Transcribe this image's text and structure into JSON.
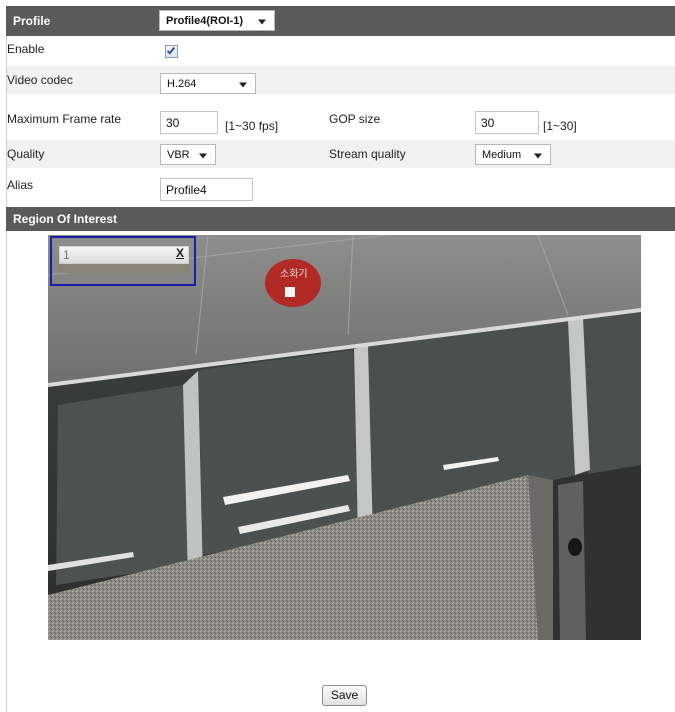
{
  "header": {
    "profile_label": "Profile",
    "profile_value": "Profile4(ROI-1)"
  },
  "enable": {
    "label": "Enable",
    "checked": true
  },
  "video_codec": {
    "label": "Video codec",
    "value": "H.264"
  },
  "frame_rate": {
    "label": "Maximum Frame rate",
    "value": "30",
    "range": "[1~30 fps]"
  },
  "gop": {
    "label": "GOP size",
    "value": "30",
    "range": "[1~30]"
  },
  "quality": {
    "label": "Quality",
    "value": "VBR"
  },
  "stream_quality": {
    "label": "Stream quality",
    "value": "Medium"
  },
  "alias": {
    "label": "Alias",
    "value": "Profile4"
  },
  "roi_section": {
    "title": "Region Of Interest"
  },
  "roi_box": {
    "number": "1",
    "close": "X"
  },
  "sign_text": "소화기",
  "save_label": "Save"
}
